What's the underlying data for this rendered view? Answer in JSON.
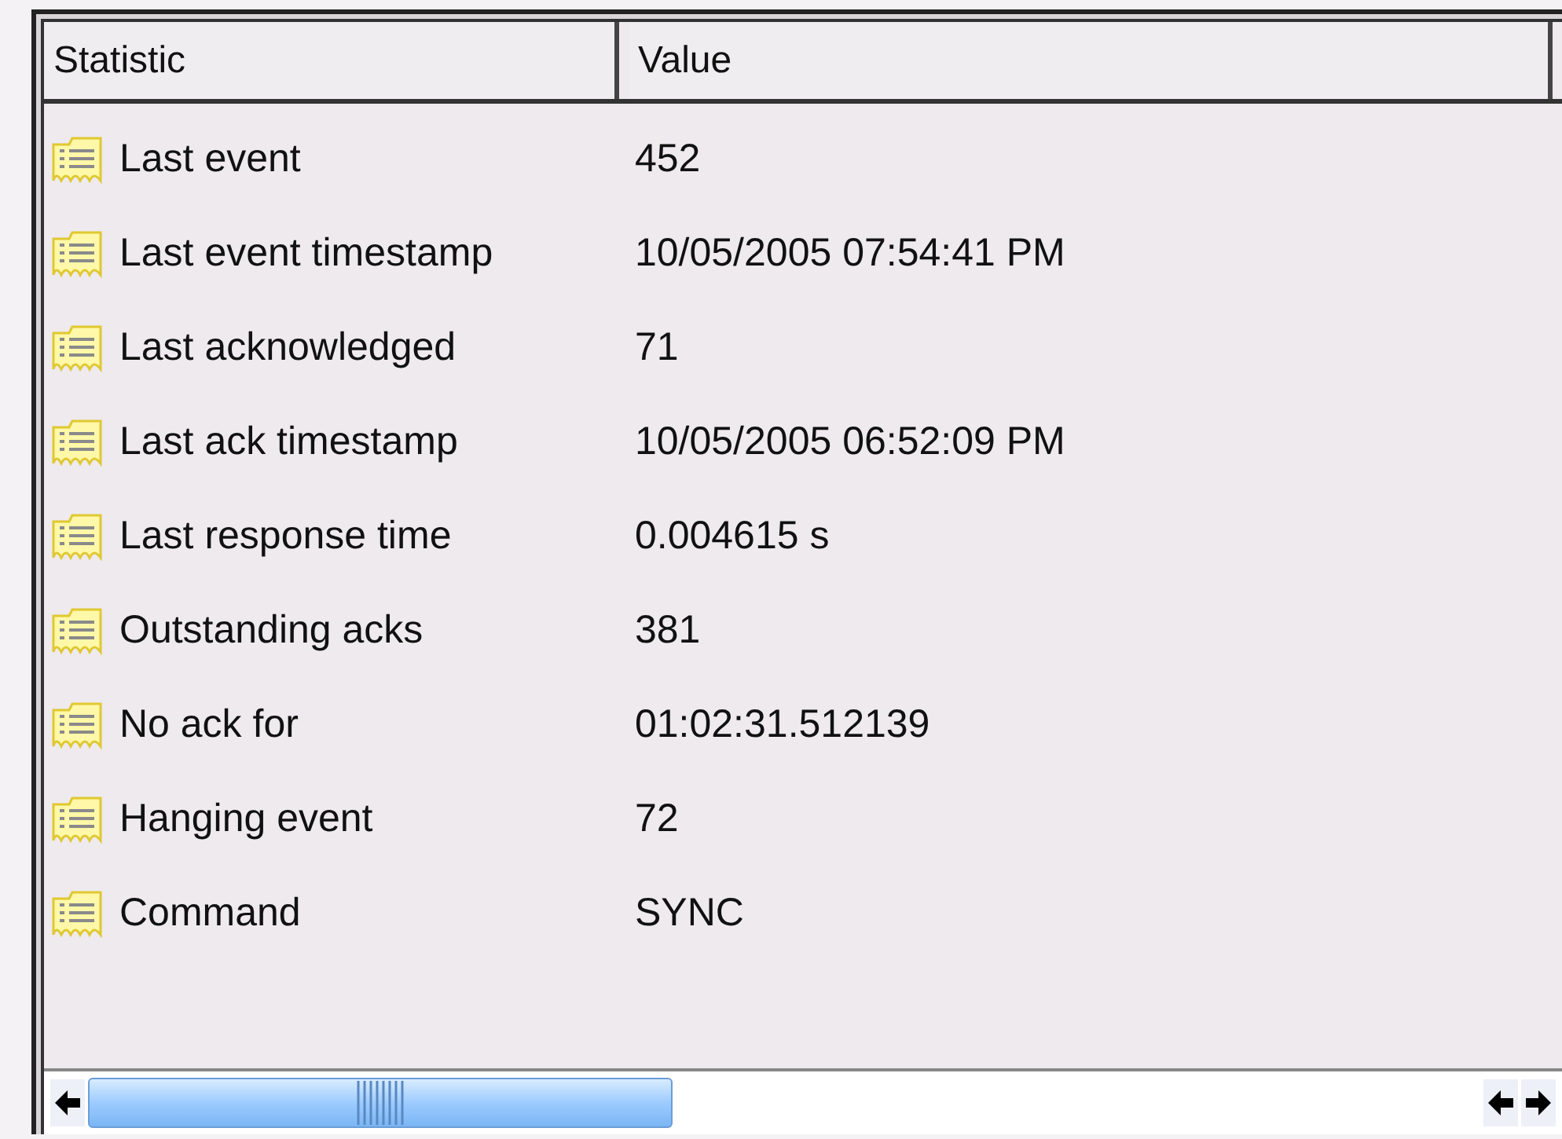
{
  "table": {
    "columns": [
      "Statistic",
      "Value"
    ],
    "rows": [
      {
        "statistic": "Last event",
        "value": "452"
      },
      {
        "statistic": "Last event timestamp",
        "value": "10/05/2005 07:54:41 PM"
      },
      {
        "statistic": "Last acknowledged",
        "value": "71"
      },
      {
        "statistic": "Last ack timestamp",
        "value": "10/05/2005 06:52:09 PM"
      },
      {
        "statistic": "Last response time",
        "value": "0.004615 s"
      },
      {
        "statistic": "Outstanding acks",
        "value": "381"
      },
      {
        "statistic": "No ack for",
        "value": "01:02:31.512139"
      },
      {
        "statistic": "Hanging event",
        "value": "72"
      },
      {
        "statistic": "Command",
        "value": "SYNC"
      }
    ]
  }
}
